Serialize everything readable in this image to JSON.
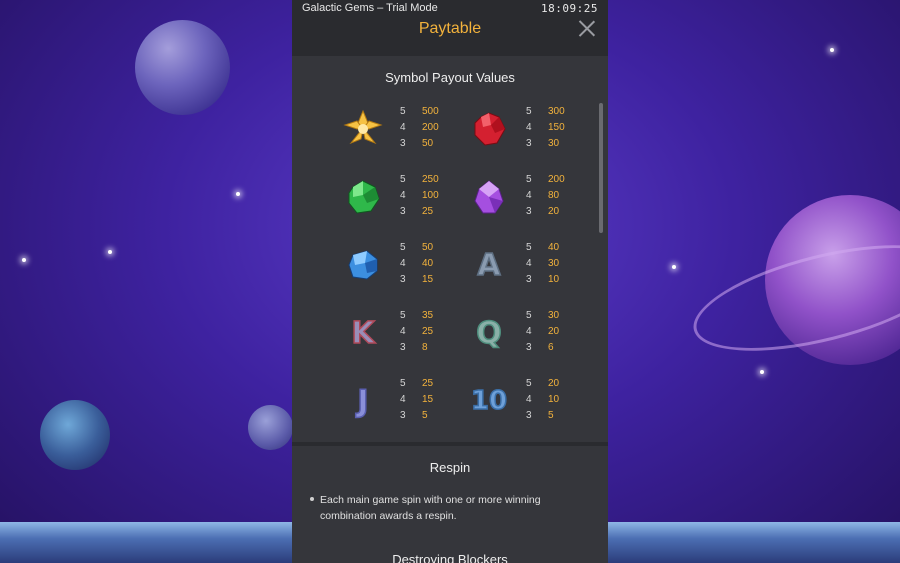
{
  "status_bar": {
    "app_title": "Galactic Gems – Trial Mode",
    "clock": "18:09:25"
  },
  "modal": {
    "title": "Paytable",
    "close_icon": "close-icon"
  },
  "payout_section": {
    "title": "Symbol Payout Values",
    "rows": [
      [
        {
          "symbol": "gold-gem-icon",
          "counts": [
            "5",
            "4",
            "3"
          ],
          "payouts": [
            "500",
            "200",
            "50"
          ]
        },
        {
          "symbol": "red-gem-icon",
          "counts": [
            "5",
            "4",
            "3"
          ],
          "payouts": [
            "300",
            "150",
            "30"
          ]
        }
      ],
      [
        {
          "symbol": "green-gem-icon",
          "counts": [
            "5",
            "4",
            "3"
          ],
          "payouts": [
            "250",
            "100",
            "25"
          ]
        },
        {
          "symbol": "purple-gem-icon",
          "counts": [
            "5",
            "4",
            "3"
          ],
          "payouts": [
            "200",
            "80",
            "20"
          ]
        }
      ],
      [
        {
          "symbol": "blue-gem-icon",
          "counts": [
            "5",
            "4",
            "3"
          ],
          "payouts": [
            "50",
            "40",
            "15"
          ]
        },
        {
          "symbol": "letter-a-icon",
          "glyph": "A",
          "counts": [
            "5",
            "4",
            "3"
          ],
          "payouts": [
            "40",
            "30",
            "10"
          ]
        }
      ],
      [
        {
          "symbol": "letter-k-icon",
          "glyph": "K",
          "counts": [
            "5",
            "4",
            "3"
          ],
          "payouts": [
            "35",
            "25",
            "8"
          ]
        },
        {
          "symbol": "letter-q-icon",
          "glyph": "Q",
          "counts": [
            "5",
            "4",
            "3"
          ],
          "payouts": [
            "30",
            "20",
            "6"
          ]
        }
      ],
      [
        {
          "symbol": "letter-j-icon",
          "glyph": "J",
          "counts": [
            "5",
            "4",
            "3"
          ],
          "payouts": [
            "25",
            "15",
            "5"
          ]
        },
        {
          "symbol": "number-10-icon",
          "glyph": "10",
          "counts": [
            "5",
            "4",
            "3"
          ],
          "payouts": [
            "20",
            "10",
            "5"
          ]
        }
      ]
    ]
  },
  "respin_section": {
    "title": "Respin",
    "bullets": [
      "Each main game spin with one or more winning combination awards a respin."
    ]
  },
  "blockers_section": {
    "title": "Destroying Blockers"
  },
  "colors": {
    "accent": "#f2b23c",
    "panel": "#35363b",
    "header": "#2a2b2f"
  }
}
